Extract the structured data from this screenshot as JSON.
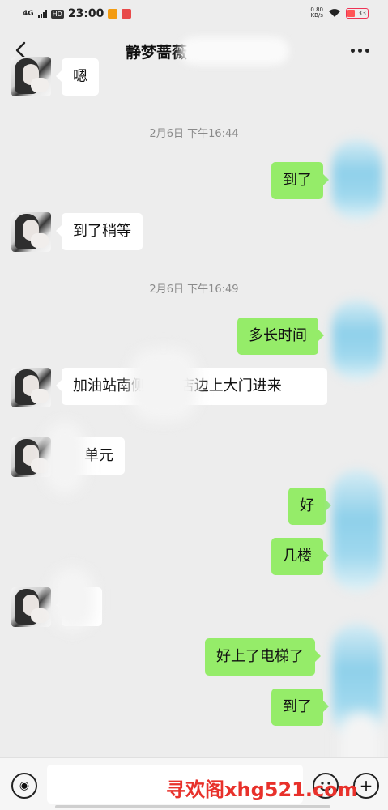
{
  "status_bar": {
    "network": "4G",
    "hd": "HD",
    "time": "23:00",
    "speed_value": "0.80",
    "speed_unit": "KB/s",
    "battery": "33",
    "colors": {
      "app_orange": "#f39c12",
      "app_red": "#e84a4a",
      "battery_fill": "#ff5555"
    }
  },
  "header": {
    "title": "静梦蔷薇",
    "back_icon": "chevron-left-icon",
    "more_icon": "more-dots-icon"
  },
  "messages": [
    {
      "side": "in",
      "text": "嗯"
    },
    {
      "type": "timestamp",
      "text": "2月6日 下午16:44"
    },
    {
      "side": "out",
      "text": "到了"
    },
    {
      "side": "in",
      "text": "到了稍等"
    },
    {
      "type": "timestamp",
      "text": "2月6日 下午16:49"
    },
    {
      "side": "out",
      "text": "多长时间"
    },
    {
      "side": "in",
      "text": "加油站南侧 便利店边上大门进来"
    },
    {
      "side": "in",
      "text": "单元"
    },
    {
      "side": "out",
      "text": "好"
    },
    {
      "side": "out",
      "text": "几楼"
    },
    {
      "side": "in",
      "text": ""
    },
    {
      "side": "out",
      "text": "好上了电梯了"
    },
    {
      "side": "out",
      "text": "到了"
    }
  ],
  "input_bar": {
    "voice_icon": "voice-icon",
    "emoji_icon": "emoji-icon",
    "plus_icon": "plus-icon",
    "voice_glyph": "◉",
    "plus_glyph": "+",
    "input_value": "",
    "placeholder": ""
  },
  "watermark": "寻欢阁xhg521.com",
  "colors": {
    "background": "#ededed",
    "bubble_out": "#95ec69",
    "bubble_in": "#ffffff",
    "timestamp": "#8a8a8a",
    "watermark": "#e8312b"
  }
}
